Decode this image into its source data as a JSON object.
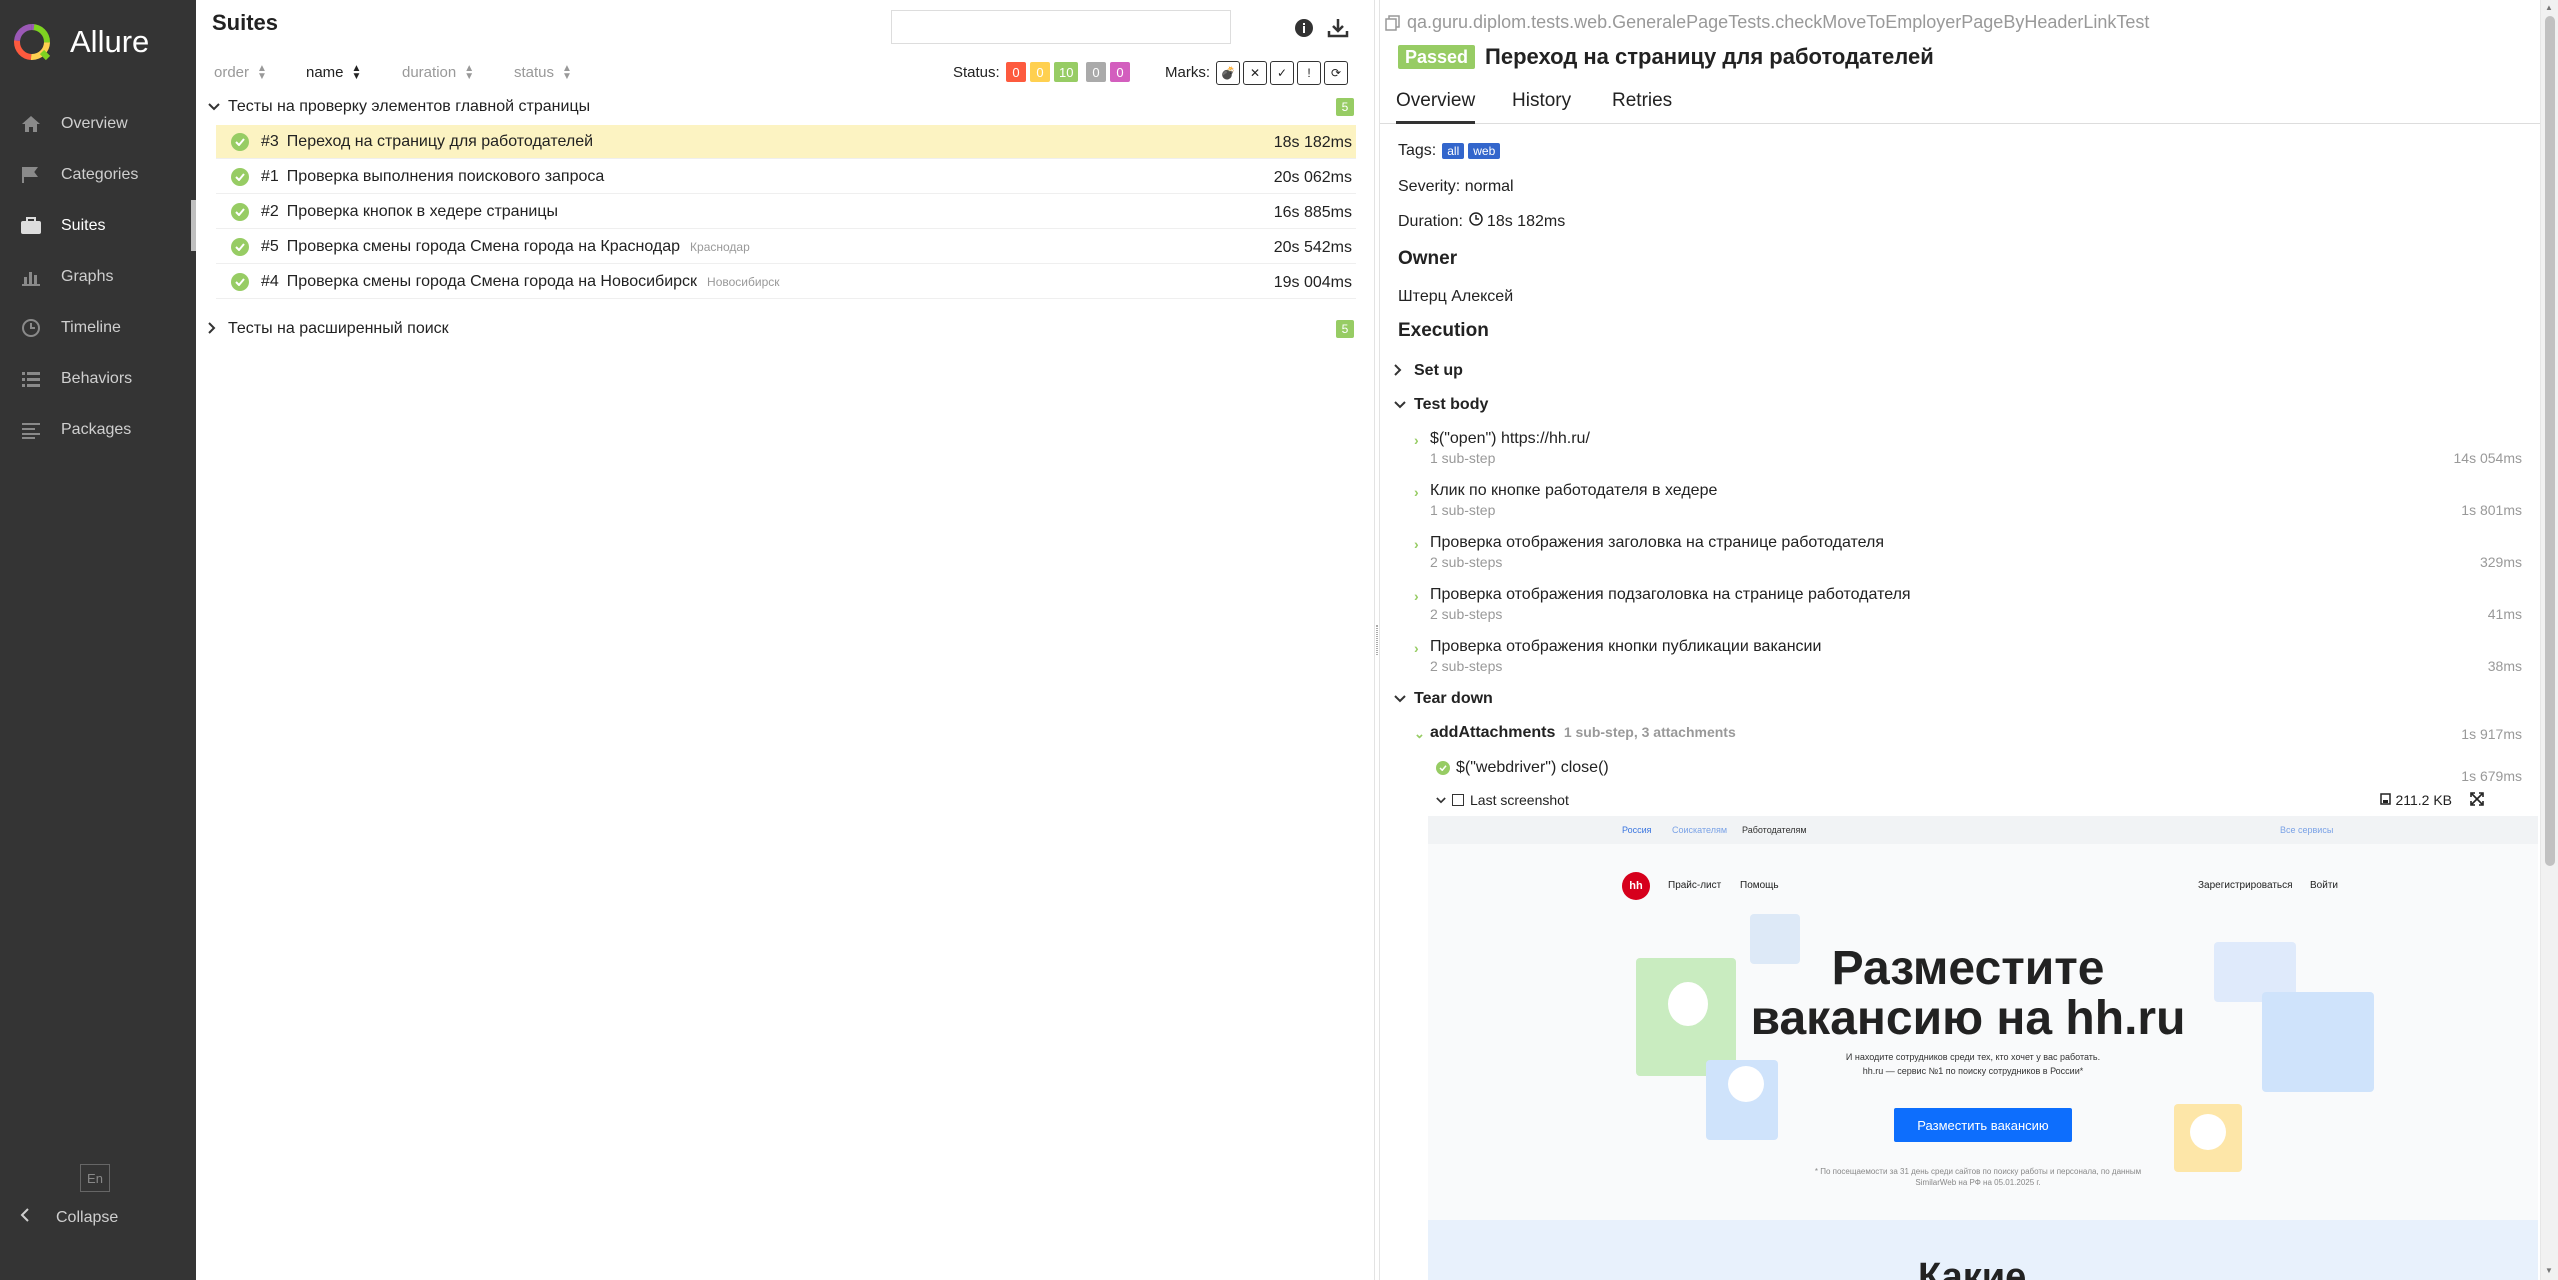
{
  "sidebar": {
    "brand": "Allure",
    "items": [
      {
        "label": "Overview",
        "icon": "home-icon"
      },
      {
        "label": "Categories",
        "icon": "flag-icon"
      },
      {
        "label": "Suites",
        "icon": "briefcase-icon",
        "active": true
      },
      {
        "label": "Graphs",
        "icon": "bar-chart-icon"
      },
      {
        "label": "Timeline",
        "icon": "clock-icon"
      },
      {
        "label": "Behaviors",
        "icon": "list-icon"
      },
      {
        "label": "Packages",
        "icon": "align-left-icon"
      }
    ],
    "lang": "En",
    "collapse_label": "Collapse"
  },
  "suites": {
    "title": "Suites",
    "search_value": "",
    "sort": {
      "order": "order",
      "name": "name",
      "duration": "duration",
      "status": "status"
    },
    "status_label": "Status:",
    "status_counts": [
      {
        "value": "0",
        "color": "#fd5a3e"
      },
      {
        "value": "0",
        "color": "#ffd050"
      },
      {
        "value": "10",
        "color": "#97cc64"
      },
      {
        "value": "0",
        "color": "#aaaaaa"
      },
      {
        "value": "0",
        "color": "#d35ebe"
      }
    ],
    "marks_label": "Marks:",
    "groups": [
      {
        "name": "Тесты на проверку элементов главной страницы",
        "count": "5",
        "expanded": true,
        "tests": [
          {
            "num": "#3",
            "name": "Переход на страницу для работодателей",
            "param": "",
            "duration": "18s 182ms",
            "selected": true
          },
          {
            "num": "#1",
            "name": "Проверка выполнения поискового запроса",
            "param": "",
            "duration": "20s 062ms"
          },
          {
            "num": "#2",
            "name": "Проверка кнопок в хедере страницы",
            "param": "",
            "duration": "16s 885ms"
          },
          {
            "num": "#5",
            "name": "Проверка смены города Смена города на Краснодар",
            "param": "Краснодар",
            "duration": "20s 542ms"
          },
          {
            "num": "#4",
            "name": "Проверка смены города Смена города на Новосибирск",
            "param": "Новосибирск",
            "duration": "19s 004ms"
          }
        ]
      },
      {
        "name": "Тесты на расширенный поиск",
        "count": "5",
        "expanded": false,
        "tests": []
      }
    ]
  },
  "details": {
    "full_name": "qa.guru.diplom.tests.web.GeneralePageTests.checkMoveToEmployerPageByHeaderLinkTest",
    "status": "Passed",
    "title": "Переход на страницу для работодателей",
    "tabs": [
      "Overview",
      "History",
      "Retries"
    ],
    "tags_label": "Tags:",
    "tags": [
      "all",
      "web"
    ],
    "severity": "Severity: normal",
    "duration_label": "Duration:",
    "duration": "18s 182ms",
    "owner_heading": "Owner",
    "owner": "Штерц Алексей",
    "execution_heading": "Execution",
    "setup_label": "Set up",
    "test_body_label": "Test body",
    "steps": [
      {
        "name": "$(\"open\") https://hh.ru/",
        "sub": "1 sub-step",
        "duration": "14s 054ms"
      },
      {
        "name": "Клик по кнопке работодателя в хедере",
        "sub": "1 sub-step",
        "duration": "1s 801ms"
      },
      {
        "name": "Проверка отображения заголовка на странице работодателя",
        "sub": "2 sub-steps",
        "duration": "329ms"
      },
      {
        "name": "Проверка отображения подзаголовка на странице работодателя",
        "sub": "2 sub-steps",
        "duration": "41ms"
      },
      {
        "name": "Проверка отображения кнопки публикации вакансии",
        "sub": "2 sub-steps",
        "duration": "38ms"
      }
    ],
    "teardown_label": "Tear down",
    "teardown": {
      "name": "addAttachments",
      "meta": "1 sub-step, 3 attachments",
      "duration": "1s 917ms",
      "substep": "$(\"webdriver\") close()",
      "substep_duration": "1s 679ms",
      "attachment": "Last screenshot",
      "attachment_size": "211.2 KB"
    }
  },
  "preview": {
    "topbar": [
      "Россия",
      "Соискателям",
      "Работодателям",
      "Все сервисы"
    ],
    "logo": "hh",
    "links": [
      "Прайс-лист",
      "Помощь",
      "Зарегистрироваться",
      "Войти"
    ],
    "headline": "Разместите вакансию на hh.ru",
    "sub1": "И находите сотрудников среди тех, кто хочет у вас работать.",
    "sub2": "hh.ru — сервис №1 по поиску сотрудников в России*",
    "button": "Разместить вакансию",
    "footnote": "* По посещаемости за 31 день среди сайтов по поиску работы и персонала, по данным SimilarWeb на РФ на 05.01.2025 г.",
    "bottom": "Какие"
  }
}
